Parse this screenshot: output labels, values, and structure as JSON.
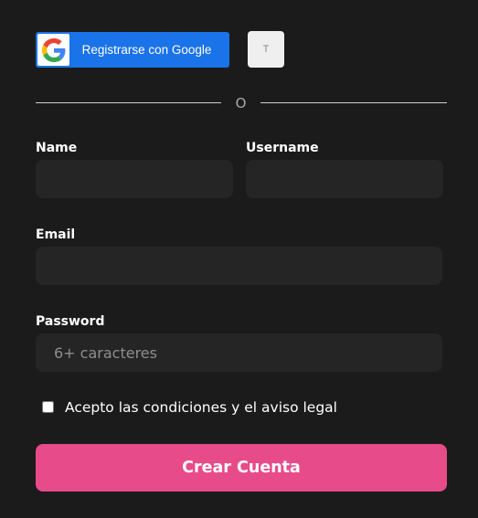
{
  "social": {
    "google_label": "Registrarse con Google",
    "google_icon": "google-g-logo",
    "alt_label": "T"
  },
  "divider": {
    "text": "O"
  },
  "form": {
    "name_label": "Name",
    "name_value": "",
    "name_placeholder": "",
    "username_label": "Username",
    "username_value": "",
    "username_placeholder": "",
    "email_label": "Email",
    "email_value": "",
    "email_placeholder": "",
    "password_label": "Password",
    "password_value": "",
    "password_placeholder": "6+ caracteres",
    "terms_label": "Acepto las condiciones y el aviso legal",
    "terms_checked": false,
    "submit_label": "Crear Cuenta"
  },
  "colors": {
    "background": "#1b1b1b",
    "input_background": "#252525",
    "google_blue": "#1a73e8",
    "submit_pink": "#e84b8a"
  }
}
